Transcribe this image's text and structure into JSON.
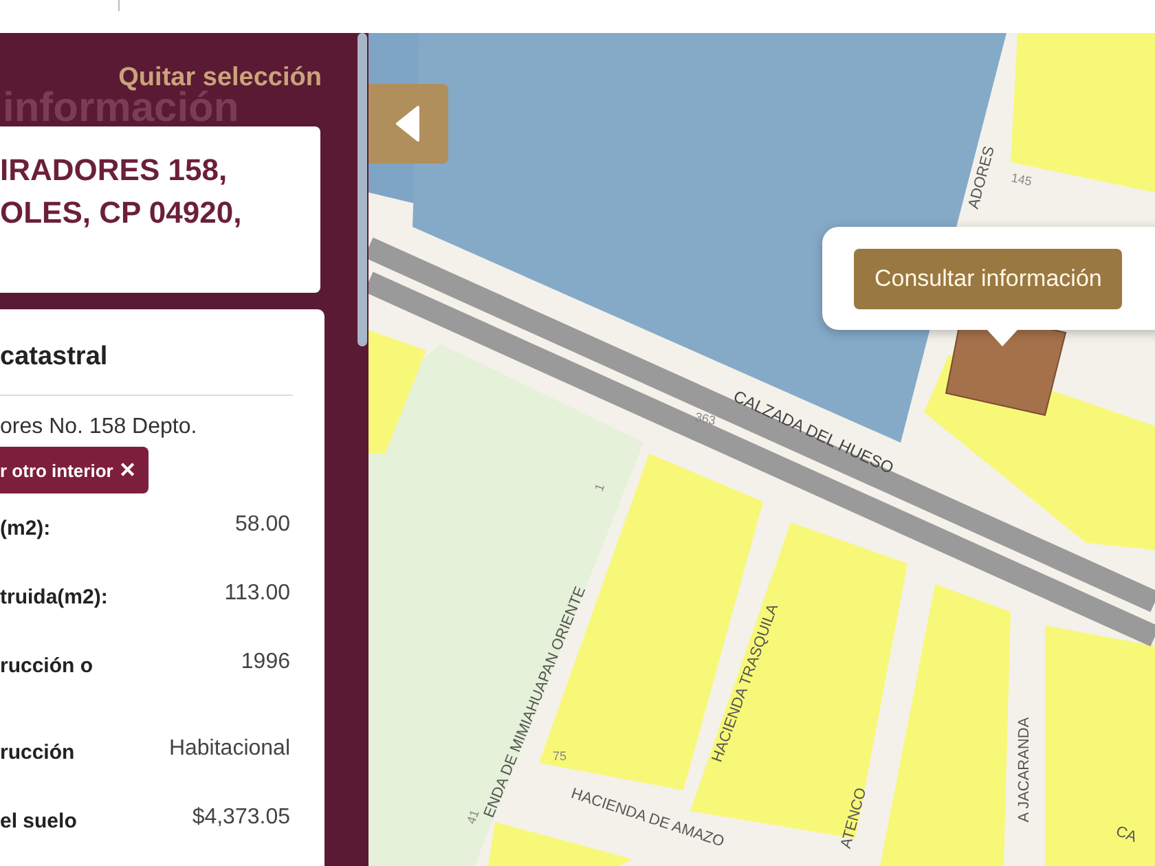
{
  "panel": {
    "clear_selection": "Quitar selección",
    "watermark": "información",
    "address_lines": [
      "IRADORES 158,",
      "OLES, CP 04920,"
    ],
    "section_title": "catastral",
    "unit_line": "ores No. 158 Depto.",
    "other_unit_button": {
      "label": "r otro interior",
      "icon": "✕"
    },
    "fields": [
      {
        "label": "(m2):",
        "value": "58.00"
      },
      {
        "label": "truida(m2):",
        "value": "113.00"
      },
      {
        "label": "rucción o",
        "value": "1996"
      },
      {
        "label": "rucción",
        "value": "Habitacional"
      },
      {
        "label": "el suelo",
        "value": "$4,373.05"
      }
    ]
  },
  "map": {
    "popup_button": "Consultar información",
    "street_labels": [
      "CALZADA DEL HUESO",
      "HACIENDA TRASQUILA",
      "ENDA DE MIMIAHUAPAN ORIENTE",
      "HACIENDA DE AMAZO",
      "ATENCO",
      "A JACARANDA",
      "ADORES",
      "CA"
    ],
    "lot_numbers": [
      "145",
      "363",
      "1",
      "75",
      "41"
    ]
  }
}
